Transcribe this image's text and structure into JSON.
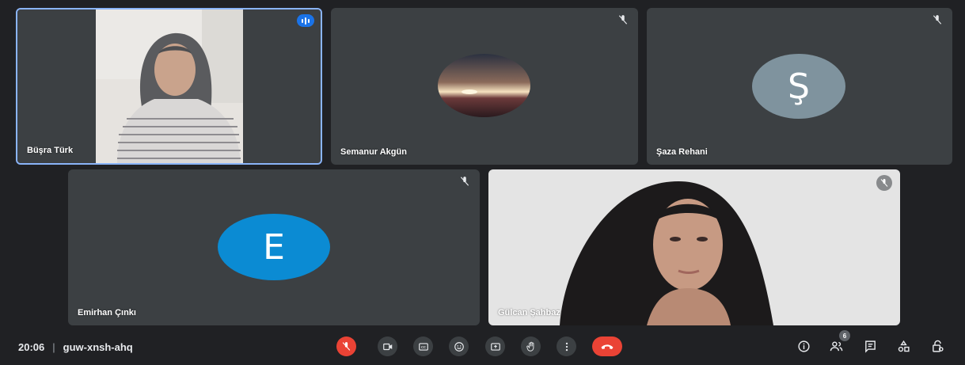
{
  "participants": [
    {
      "name": "Büşra Türk"
    },
    {
      "name": "Semanur Akgün"
    },
    {
      "name": "Şaza Rehani",
      "initial": "Ş",
      "avatar_color": "#7f939e"
    },
    {
      "name": "Emirhan Çınkı",
      "initial": "E",
      "avatar_color": "#0b8bd3"
    },
    {
      "name": "Gülcan Şahbaz"
    }
  ],
  "meeting": {
    "time": "20:06",
    "separator": "|",
    "code": "guw-xnsh-ahq"
  },
  "people_count": "6",
  "controls": [
    "mic-off",
    "camera",
    "captions",
    "emoji",
    "present",
    "raise-hand",
    "more-options",
    "end-call"
  ],
  "right_controls": [
    "info",
    "people",
    "chat",
    "activities",
    "host-controls"
  ],
  "colors": {
    "background": "#202124",
    "tile": "#3c4043",
    "active_border": "#8ab4f8",
    "danger": "#ea4335",
    "speaking": "#1a73e8"
  }
}
